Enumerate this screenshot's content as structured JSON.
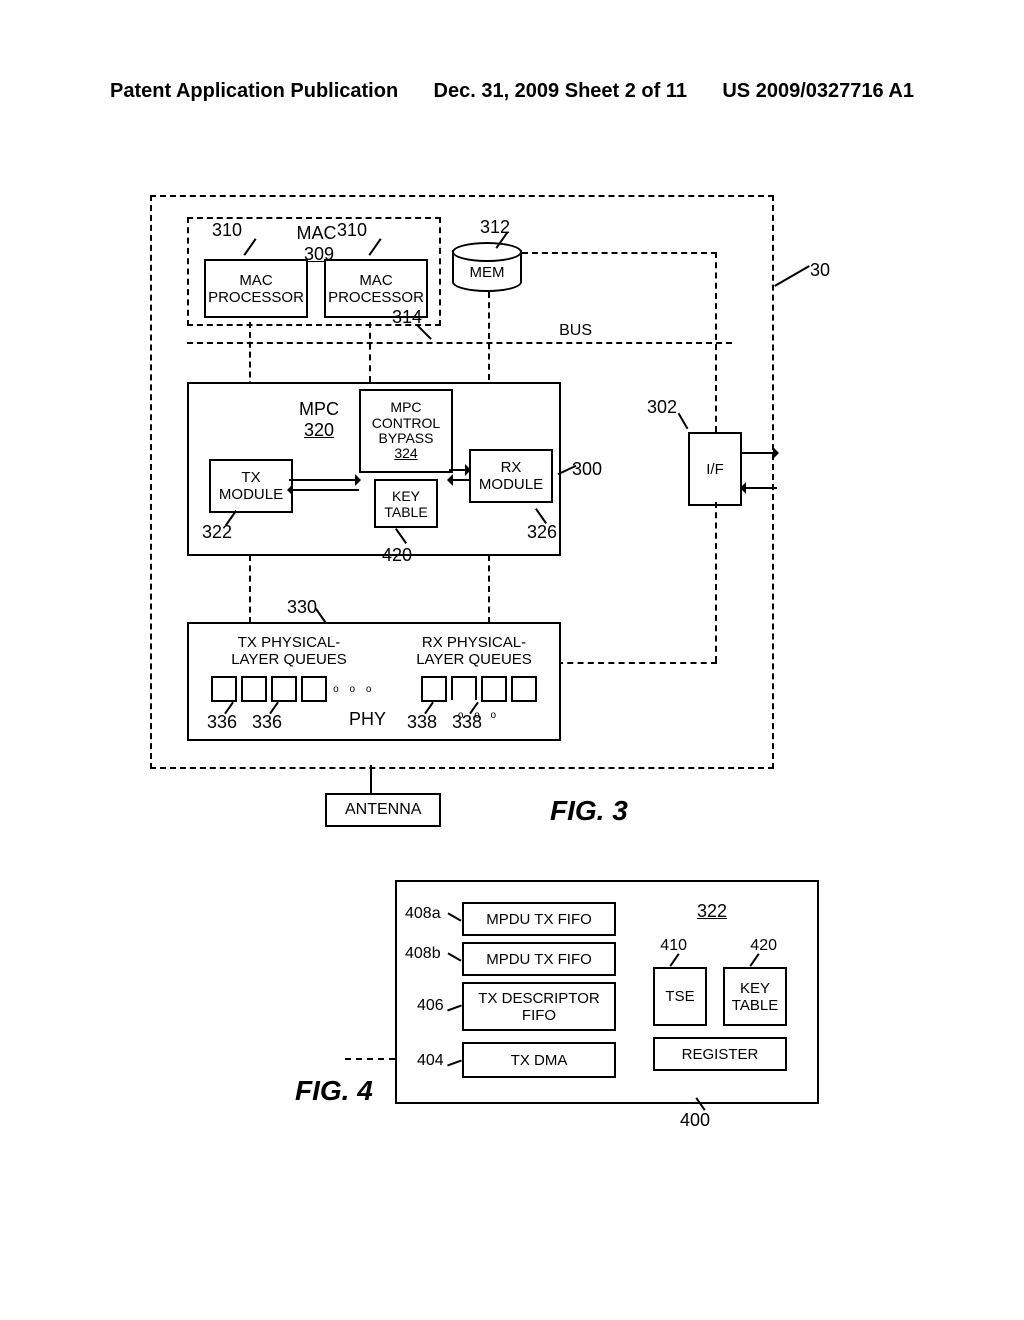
{
  "header": {
    "left": "Patent Application Publication",
    "mid": "Dec. 31, 2009   Sheet 2 of 11",
    "right": "US 2009/0327716 A1"
  },
  "fig3": {
    "label": "FIG. 3",
    "sys_ref": "30",
    "mac": {
      "box_ref": "309",
      "proc_left_ref": "310",
      "proc_right_ref": "310",
      "proc_label": "MAC\nPROCESSOR",
      "title": "MAC"
    },
    "mem": {
      "label": "MEM",
      "ref": "312"
    },
    "bus": {
      "label": "BUS",
      "ref": "314"
    },
    "mpc": {
      "mpc_label": "MPC",
      "mpc_ref": "320",
      "ctrl_label": "MPC\nCONTROL\nBYPASS",
      "ctrl_ref": "324",
      "tx_label": "TX\nMODULE",
      "tx_ref": "322",
      "key_label": "KEY\nTABLE",
      "key_ref": "420",
      "rx_label": "RX\nMODULE",
      "rx_ref": "326",
      "box_ref": "300"
    },
    "if": {
      "label": "I/F",
      "ref": "302"
    },
    "phy": {
      "box_ref": "330",
      "tx_title": "TX PHYSICAL-\nLAYER QUEUES",
      "rx_title": "RX PHYSICAL-\nLAYER QUEUES",
      "tx_item_ref": "336",
      "rx_item_ref": "338",
      "phy_label": "PHY"
    },
    "antenna": "ANTENNA"
  },
  "fig4": {
    "label": "FIG. 4",
    "mpdu_a": {
      "label": "MPDU TX FIFO",
      "ref": "408a"
    },
    "mpdu_b": {
      "label": "MPDU TX FIFO",
      "ref": "408b"
    },
    "txdesc": {
      "label": "TX DESCRIPTOR\nFIFO",
      "ref": "406"
    },
    "txdma": {
      "label": "TX DMA",
      "ref": "404"
    },
    "module_ref": "322",
    "tse": {
      "label": "TSE",
      "ref": "410"
    },
    "key": {
      "label": "KEY\nTABLE",
      "ref": "420"
    },
    "reg": {
      "label": "REGISTER",
      "ref": "400"
    }
  }
}
